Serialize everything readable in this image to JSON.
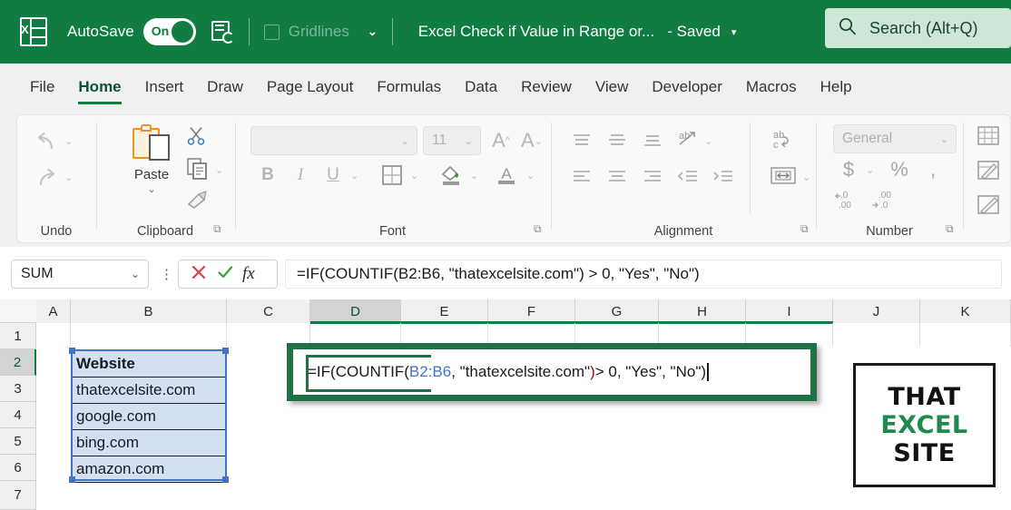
{
  "titlebar": {
    "app_icon": "excel-logo",
    "autosave_label": "AutoSave",
    "autosave_state": "On",
    "save_icon": "save-refresh-icon",
    "gridlines_label": "Gridlines",
    "gridlines_checked": false,
    "qat_chevron": "⌄",
    "document_title": "Excel Check if Value in Range or...",
    "save_status": "- Saved",
    "status_chevron": "▾",
    "search_placeholder": "Search (Alt+Q)",
    "bg_color": "#107c41"
  },
  "tabs": [
    {
      "label": "File",
      "active": false
    },
    {
      "label": "Home",
      "active": true
    },
    {
      "label": "Insert",
      "active": false
    },
    {
      "label": "Draw",
      "active": false
    },
    {
      "label": "Page Layout",
      "active": false
    },
    {
      "label": "Formulas",
      "active": false
    },
    {
      "label": "Data",
      "active": false
    },
    {
      "label": "Review",
      "active": false
    },
    {
      "label": "View",
      "active": false
    },
    {
      "label": "Developer",
      "active": false
    },
    {
      "label": "Macros",
      "active": false
    },
    {
      "label": "Help",
      "active": false
    }
  ],
  "ribbon": {
    "groups": [
      {
        "name": "Undo",
        "label": "Undo"
      },
      {
        "name": "Clipboard",
        "label": "Clipboard",
        "paste_label": "Paste"
      },
      {
        "name": "Font",
        "label": "Font",
        "font_name": "",
        "font_size": "11"
      },
      {
        "name": "Alignment",
        "label": "Alignment"
      },
      {
        "name": "Number",
        "label": "Number",
        "format": "General"
      },
      {
        "name": "Styles",
        "label": ""
      }
    ],
    "number_format": "General",
    "font_size": "11",
    "accent_color": "#107c41"
  },
  "formula_bar": {
    "name_box": "SUM",
    "cancel_icon": "cancel-x-icon",
    "enter_icon": "confirm-check-icon",
    "fx_icon": "fx-icon",
    "formula": "=IF(COUNTIF(B2:B6, \"thatexcelsite.com\") > 0, \"Yes\", \"No\")"
  },
  "grid": {
    "columns": [
      "A",
      "B",
      "C",
      "D",
      "E",
      "F",
      "G",
      "H",
      "I",
      "J",
      "K"
    ],
    "active_column": "D",
    "rows": [
      "1",
      "2",
      "3",
      "4",
      "5",
      "6",
      "7"
    ],
    "active_row": "2",
    "data_column_header": "Website",
    "data_values": [
      "Website",
      "thatexcelsite.com",
      "google.com",
      "bing.com",
      "amazon.com"
    ],
    "selected_range": "B2:B6",
    "selection_color": "#4472c4"
  },
  "cell_editor": {
    "cell": "D2",
    "parts": [
      {
        "text": "=IF(COUNTIF(",
        "color": "default"
      },
      {
        "text": "B2:B6",
        "color": "#4472c4"
      },
      {
        "text": ", \"thatexcelsite.com\"",
        "color": "default"
      },
      {
        "text": ")",
        "color": "#c00000"
      },
      {
        "text": " > 0, \"Yes\", \"No\")",
        "color": "default"
      }
    ],
    "full_text": "=IF(COUNTIF(B2:B6, \"thatexcelsite.com\") > 0, \"Yes\", \"No\")",
    "highlight_color": "#1e7145"
  },
  "logo": {
    "line1": "THAT",
    "line2": "EXCEL",
    "line3": "SITE",
    "line2_color": "#1d8a4e",
    "border_color": "#1a1a1a"
  }
}
